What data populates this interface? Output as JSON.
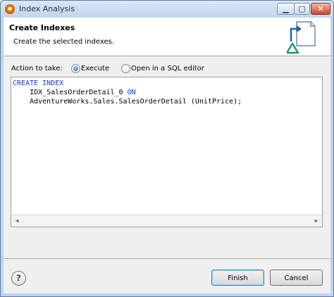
{
  "window": {
    "title": "Index Analysis",
    "controls": {
      "minimize": "▁",
      "maximize": "▢",
      "close": "✕"
    }
  },
  "banner": {
    "title": "Create Indexes",
    "description": "Create the selected indexes.",
    "icon": "new-index-file-icon"
  },
  "action": {
    "label": "Action to take:",
    "options": [
      {
        "label": "Execute",
        "selected": true
      },
      {
        "label": "Open in a SQL editor",
        "selected": false
      }
    ]
  },
  "editor": {
    "lines": [
      {
        "keyword": "CREATE INDEX",
        "text": ""
      },
      {
        "indent": "    ",
        "text": "IDX_SalesOrderDetail_0 ",
        "keyword": "ON"
      },
      {
        "indent": "    ",
        "text": "AdventureWorks.Sales.SalesOrderDetail (UnitPrice);"
      }
    ]
  },
  "footer": {
    "help": "?",
    "finish_label": "Finish",
    "cancel_label": "Cancel"
  },
  "colors": {
    "keyword": "#1a35c8",
    "focus_border": "#3c7fb1",
    "radio_selected": "#1a5fb4"
  }
}
